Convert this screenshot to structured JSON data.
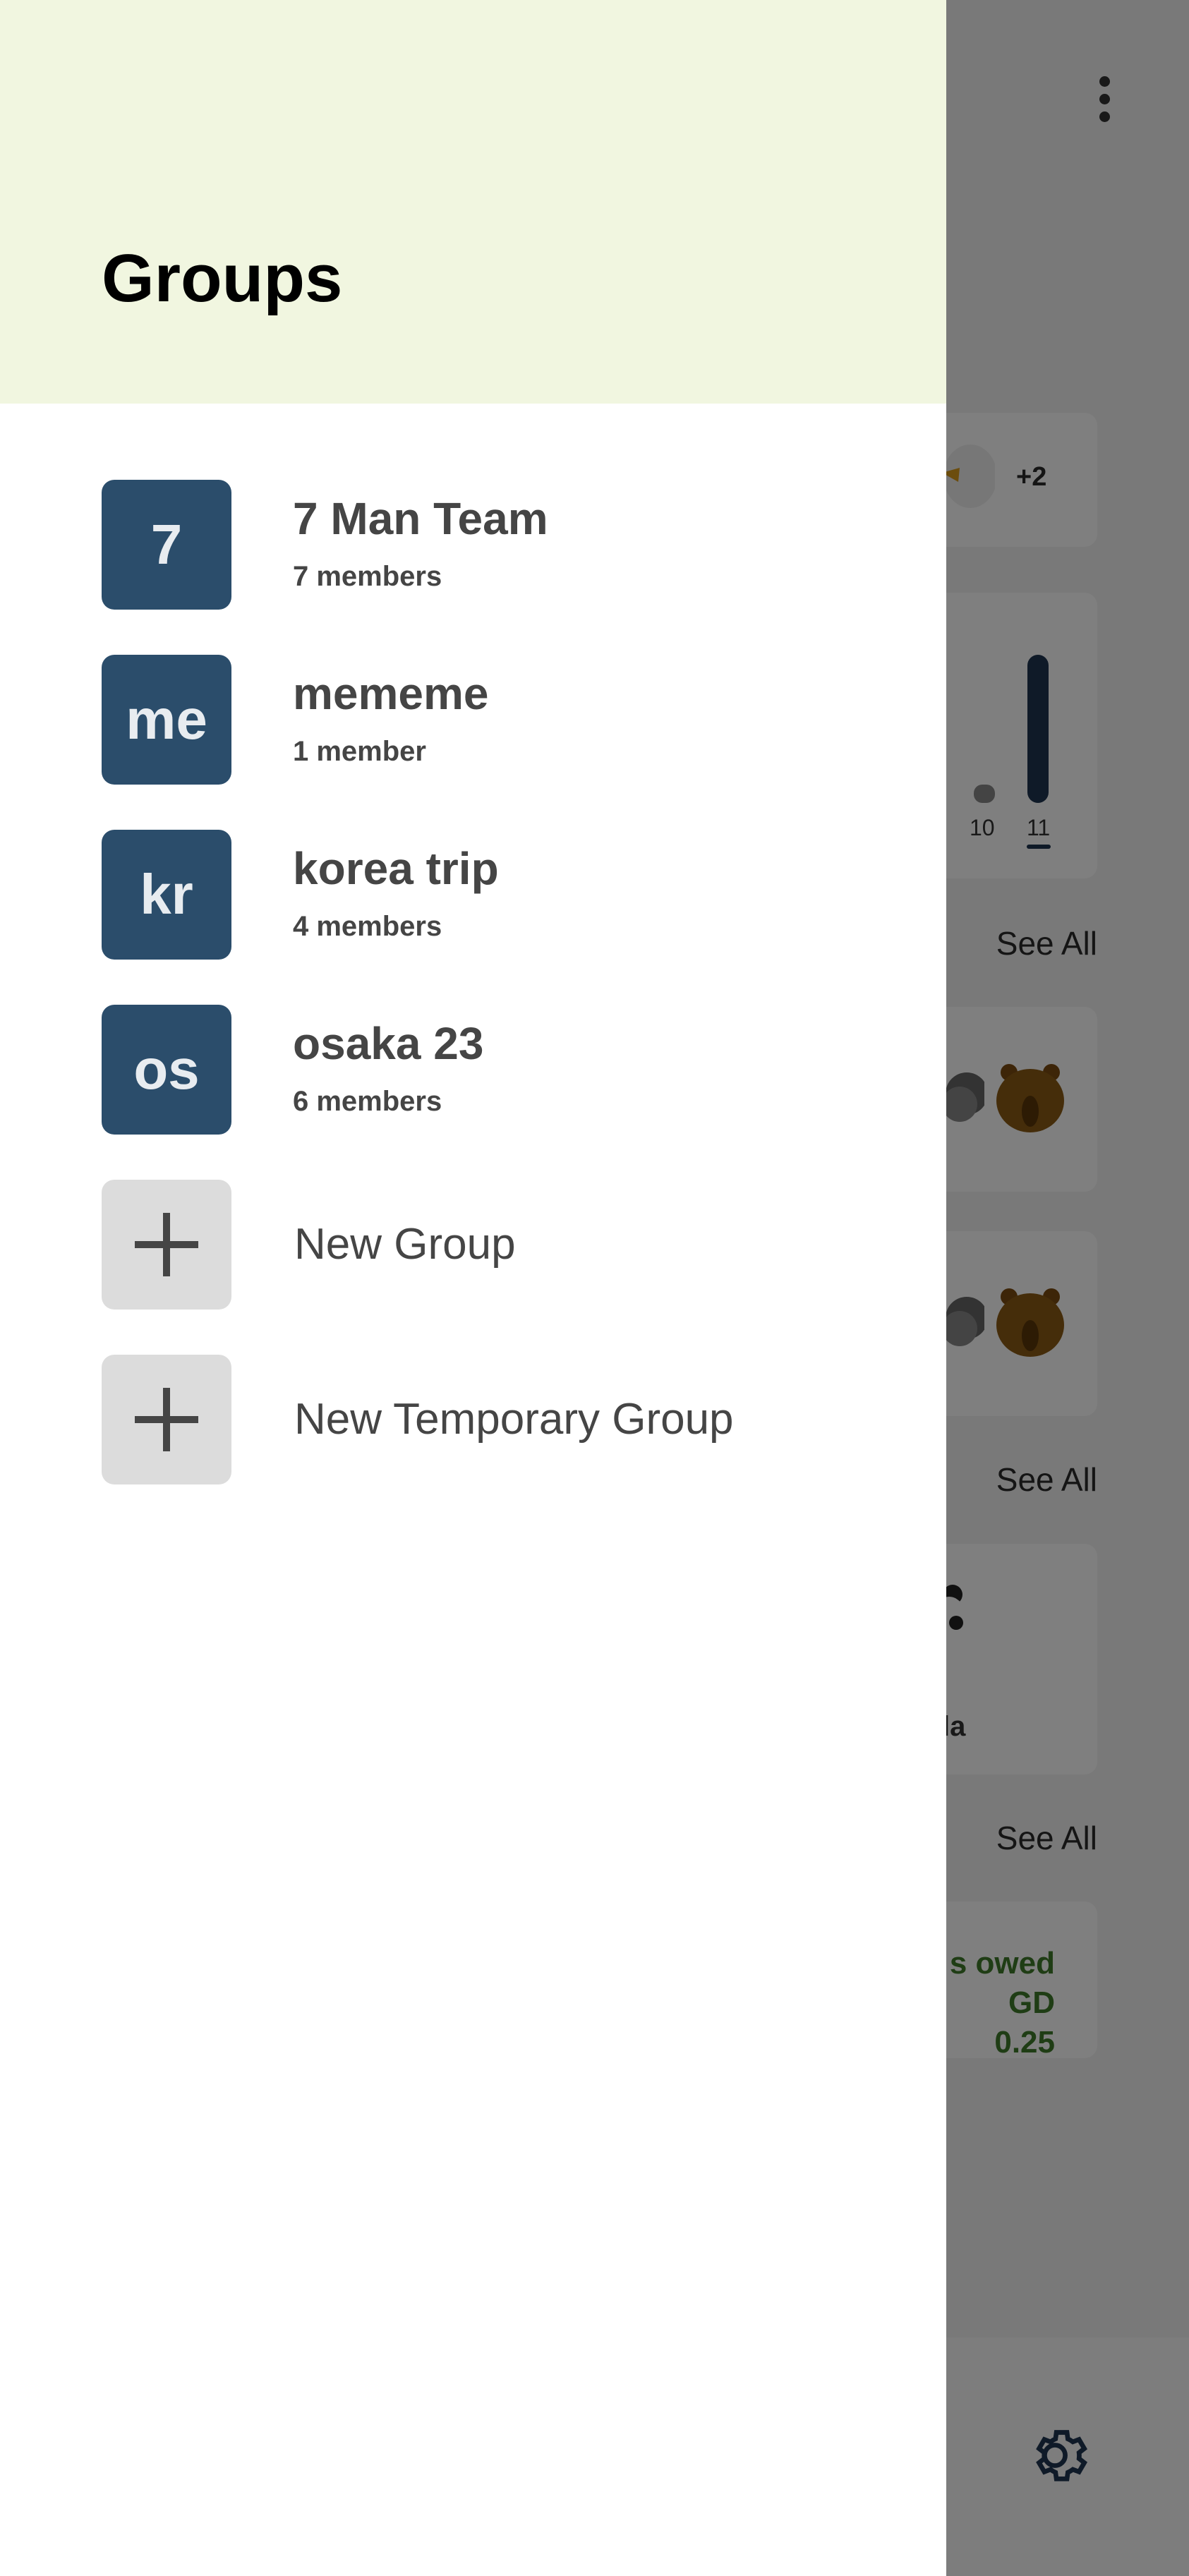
{
  "drawer": {
    "title": "Groups",
    "groups": [
      {
        "avatar": "7",
        "name": "7 Man Team",
        "members": "7 members"
      },
      {
        "avatar": "me",
        "name": "mememe",
        "members": "1 member"
      },
      {
        "avatar": "kr",
        "name": "korea trip",
        "members": "4 members"
      },
      {
        "avatar": "os",
        "name": "osaka 23",
        "members": "6 members"
      }
    ],
    "actions": [
      {
        "label": "New Group",
        "icon": "plus-icon"
      },
      {
        "label": "New Temporary Group",
        "icon": "plus-icon"
      }
    ]
  },
  "background": {
    "extra_members": "+2",
    "chart_labels": [
      "10",
      "11"
    ],
    "see_all_labels": [
      "See All",
      "See All",
      "See All"
    ],
    "partial_name": "la",
    "owed_line1": "s owed",
    "owed_line2": "GD 0.25",
    "icons": [
      "more-vert-icon",
      "eagle-avatar-icon",
      "bear-avatar-icon",
      "koala-avatar-icon",
      "panda-avatar-icon",
      "gear-icon"
    ]
  },
  "colors": {
    "header_bg": "#f1f6e0",
    "avatar_bg": "#2b4d6b",
    "add_bg": "#dcdcdc",
    "text": "#454545",
    "owed_green": "#3f7a2a"
  }
}
